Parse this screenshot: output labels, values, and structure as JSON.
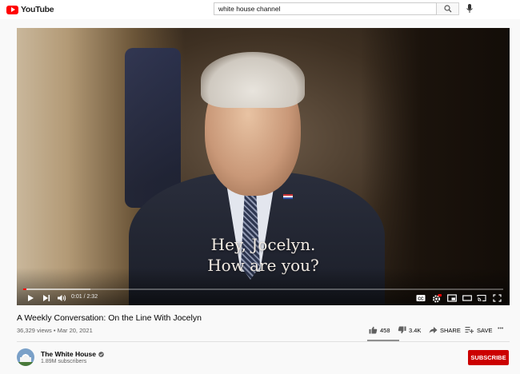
{
  "header": {
    "logo_text": "YouTube",
    "search_value": "white house channel"
  },
  "player": {
    "caption_line1": "Hey, Jocelyn.",
    "caption_line2": "How are you?",
    "time": "0:01 / 2:32",
    "progress_played_fraction": 0.007,
    "progress_buffered_fraction": 0.14
  },
  "video": {
    "title": "A Weekly Conversation: On the Line With Jocelyn",
    "meta": "36,329 views • Mar 20, 2021",
    "likes": "458",
    "dislikes": "3.4K",
    "share_label": "SHARE",
    "save_label": "SAVE",
    "more_label": "•••"
  },
  "channel": {
    "name": "The White House",
    "subscribers": "1.89M subscribers",
    "subscribe_label": "SUBSCRIBE"
  },
  "colors": {
    "brand_red": "#ff0000",
    "subscribe_red": "#cc0000"
  }
}
